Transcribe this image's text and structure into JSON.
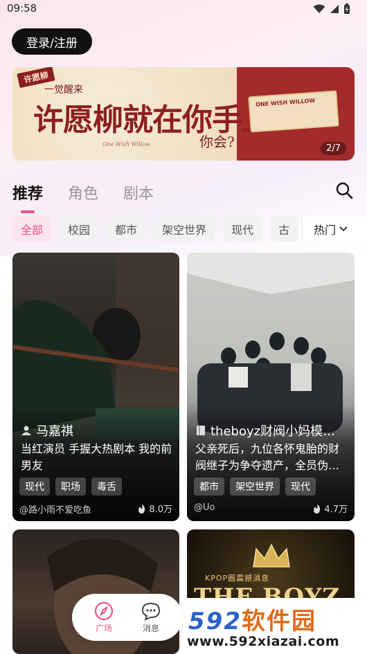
{
  "status_bar": {
    "time": "09:58"
  },
  "header": {
    "login_label": "登录/注册"
  },
  "banner": {
    "tag": "许愿柳",
    "subtitle": "一觉醒来",
    "title": "许愿柳就在你手上",
    "question": "你会?",
    "signature": "One Wish Willow",
    "ticket_text": "ONE WISH WILLOW",
    "counter": "2/7"
  },
  "tabs": [
    {
      "label": "推荐",
      "active": true
    },
    {
      "label": "角色",
      "active": false
    },
    {
      "label": "剧本",
      "active": false
    }
  ],
  "filters": [
    "全部",
    "校园",
    "都市",
    "架空世界",
    "现代",
    "古"
  ],
  "sort": {
    "label": "热门"
  },
  "cards": [
    {
      "name": "马嘉祺",
      "icon": "person-icon",
      "description": "当红演员 手握大热剧本 我的前男友",
      "tags": [
        "现代",
        "职场",
        "毒舌"
      ],
      "author": "@路小雨不爱吃鱼",
      "heat": "8.0万"
    },
    {
      "name": "theboyz财阀小妈模…",
      "icon": "book-icon",
      "description": "父亲死后，九位各怀鬼胎的财阀继子为争夺遗产，全员伪…",
      "tags": [
        "都市",
        "架空世界",
        "现代"
      ],
      "author": "@Uo",
      "heat": "4.7万"
    }
  ],
  "card4": {
    "title": "KPOP圈震撼消息",
    "big": "THE BOYZ 会所"
  },
  "bottom_nav": [
    {
      "label": "广场",
      "active": true
    },
    {
      "label": "消息",
      "active": false
    }
  ],
  "watermark": {
    "brand_num": "592",
    "brand_cn": "软件园",
    "url": "www.592xiazai.com"
  },
  "colors": {
    "accent": "#f0508a",
    "banner_red": "#a32b2b"
  }
}
